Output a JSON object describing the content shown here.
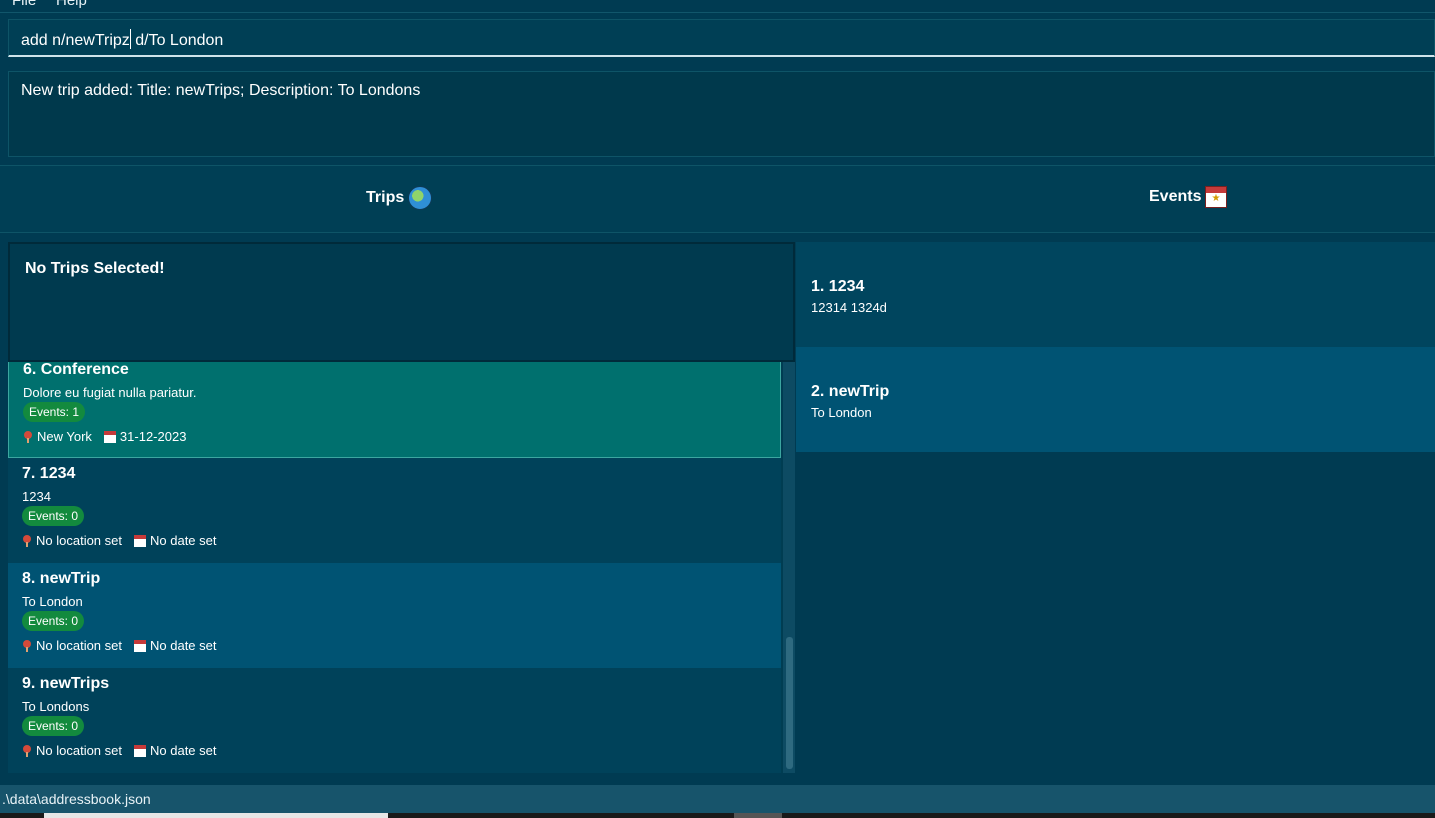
{
  "menu": {
    "file": "File",
    "help": "Help"
  },
  "command": {
    "before_caret": "add n/newTripz",
    "after_caret": " d/To London"
  },
  "result": {
    "text": "New trip added: Title: newTrips; Description: To Londons"
  },
  "panels": {
    "trips_label": "Trips",
    "events_label": "Events"
  },
  "selected": {
    "text": "No Trips Selected!"
  },
  "trips": [
    {
      "title": "6.  Conference",
      "desc": "Dolore eu fugiat nulla pariatur.",
      "badge": "Events: 1",
      "location": "New York",
      "date": "31-12-2023",
      "bg": "#00706e"
    },
    {
      "title": "7.  1234",
      "desc": "1234",
      "badge": "Events: 0",
      "location": "No location set",
      "date": "No date set",
      "bg": "#00425a"
    },
    {
      "title": "8.  newTrip",
      "desc": "To London",
      "badge": "Events: 0",
      "location": "No location set",
      "date": "No date set",
      "bg": "#005373"
    },
    {
      "title": "9.  newTrips",
      "desc": "To Londons",
      "badge": "Events: 0",
      "location": "No location set",
      "date": "No date set",
      "bg": "#00425a"
    }
  ],
  "events": [
    {
      "title": "1.  1234",
      "desc": "12314   1324d",
      "bg": "#00455e"
    },
    {
      "title": "2.  newTrip",
      "desc": "To London",
      "bg": "#005373"
    }
  ],
  "status": {
    "path": ".\\data\\addressbook.json"
  },
  "colors": {
    "background": "#003b52",
    "badge": "#138a3e",
    "selected_card": "#00706e"
  }
}
